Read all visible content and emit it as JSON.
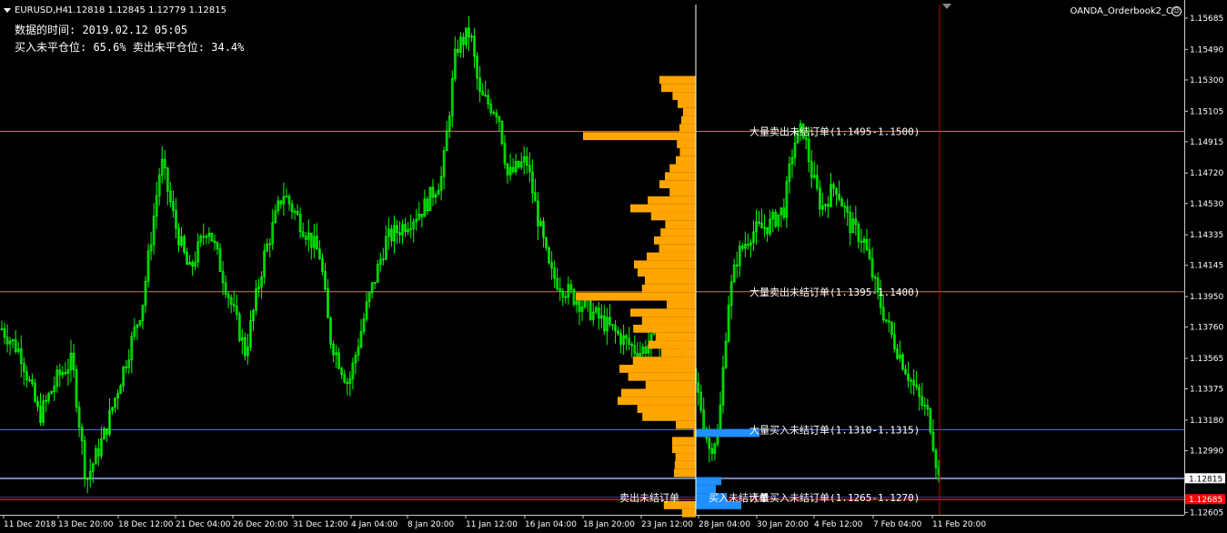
{
  "header": {
    "symbol": "EURUSD,H4",
    "ohlc": "1.12818 1.12845 1.12779 1.12815",
    "data_time_label": "数据的时间: 2019.02.12 05:05",
    "position_label": "买入未平仓位: 65.6% 卖出未平仓位: 34.4%",
    "indicator_name": "OANDA_Orderbook2_C"
  },
  "colors": {
    "background": "#000000",
    "candle": "#00ff00",
    "sell_orders": "#ffa500",
    "buy_orders": "#1e90ff",
    "sell_level_line": "#d07a45",
    "buy_level_line": "#4a6fd8",
    "bid_line": "#aab4c8",
    "ask_line": "#ff0000",
    "crosshair": "#ffffff",
    "vline_red": "#c00000",
    "axis_text": "#ffffff"
  },
  "icons": [
    "dropdown-triangle-icon",
    "smiley-icon",
    "shift-marker-icon"
  ],
  "chart_data": {
    "type": "candlestick-with-orderbook-histogram",
    "symbol": "EURUSD",
    "timeframe": "H4",
    "y_axis": {
      "ticks": [
        1.15685,
        1.1549,
        1.153,
        1.15105,
        1.14915,
        1.1472,
        1.1453,
        1.14335,
        1.14145,
        1.1395,
        1.1376,
        1.13565,
        1.13375,
        1.1318,
        1.1299,
        1.12605
      ],
      "tick_labels": [
        "1.15685",
        "1.15490",
        "1.15300",
        "1.15105",
        "1.14915",
        "1.14720",
        "1.14530",
        "1.14335",
        "1.14145",
        "1.13950",
        "1.13760",
        "1.13565",
        "1.13375",
        "1.13180",
        "1.12990",
        "1.12605"
      ],
      "ylim": [
        1.1259,
        1.1577
      ]
    },
    "x_axis": {
      "ticks": [
        "11 Dec 2018",
        "13 Dec 20:00",
        "18 Dec 12:00",
        "21 Dec 04:00",
        "26 Dec 20:00",
        "31 Dec 12:00",
        "4 Jan 04:00",
        "8 Jan 20:00",
        "11 Jan 12:00",
        "16 Jan 04:00",
        "18 Jan 20:00",
        "23 Jan 12:00",
        "28 Jan 04:00",
        "30 Jan 20:00",
        "4 Feb 12:00",
        "7 Feb 04:00",
        "11 Feb 20:00"
      ]
    },
    "price_path": [
      [
        0,
        1.1375
      ],
      [
        0.02,
        1.136
      ],
      [
        0.04,
        1.132
      ],
      [
        0.06,
        1.1345
      ],
      [
        0.075,
        1.1355
      ],
      [
        0.09,
        1.128
      ],
      [
        0.11,
        1.131
      ],
      [
        0.13,
        1.135
      ],
      [
        0.15,
        1.139
      ],
      [
        0.17,
        1.148
      ],
      [
        0.185,
        1.144
      ],
      [
        0.2,
        1.141
      ],
      [
        0.22,
        1.144
      ],
      [
        0.24,
        1.14
      ],
      [
        0.26,
        1.136
      ],
      [
        0.28,
        1.142
      ],
      [
        0.3,
        1.146
      ],
      [
        0.32,
        1.144
      ],
      [
        0.34,
        1.142
      ],
      [
        0.35,
        1.137
      ],
      [
        0.37,
        1.134
      ],
      [
        0.39,
        1.139
      ],
      [
        0.41,
        1.143
      ],
      [
        0.43,
        1.144
      ],
      [
        0.45,
        1.145
      ],
      [
        0.47,
        1.147
      ],
      [
        0.485,
        1.155
      ],
      [
        0.5,
        1.156
      ],
      [
        0.51,
        1.152
      ],
      [
        0.53,
        1.151
      ],
      [
        0.54,
        1.147
      ],
      [
        0.56,
        1.148
      ],
      [
        0.57,
        1.145
      ],
      [
        0.585,
        1.141
      ],
      [
        0.6,
        1.14
      ],
      [
        0.62,
        1.139
      ],
      [
        0.64,
        1.138
      ],
      [
        0.66,
        1.137
      ],
      [
        0.68,
        1.136
      ],
      [
        0.7,
        1.137
      ],
      [
        0.715,
        1.135
      ],
      [
        0.73,
        1.136
      ],
      [
        0.745,
        1.133
      ],
      [
        0.755,
        1.13
      ],
      [
        0.765,
        1.131
      ],
      [
        0.775,
        1.139
      ],
      [
        0.785,
        1.142
      ],
      [
        0.8,
        1.1435
      ],
      [
        0.82,
        1.144
      ],
      [
        0.835,
        1.145
      ],
      [
        0.845,
        1.149
      ],
      [
        0.855,
        1.15
      ],
      [
        0.865,
        1.147
      ],
      [
        0.875,
        1.145
      ],
      [
        0.89,
        1.1465
      ],
      [
        0.905,
        1.144
      ],
      [
        0.92,
        1.143
      ],
      [
        0.935,
        1.1395
      ],
      [
        0.95,
        1.137
      ],
      [
        0.965,
        1.135
      ],
      [
        0.98,
        1.133
      ],
      [
        0.99,
        1.132
      ],
      [
        1.0,
        1.1282
      ]
    ],
    "orderbook_sell": [
      [
        1.153,
        1.0
      ],
      [
        1.1525,
        0.95
      ],
      [
        1.152,
        0.64
      ],
      [
        1.1515,
        0.5
      ],
      [
        1.151,
        0.35
      ],
      [
        1.1505,
        0.4
      ],
      [
        1.15,
        0.45
      ],
      [
        1.1495,
        3.1
      ],
      [
        1.149,
        0.52
      ],
      [
        1.1485,
        0.44
      ],
      [
        1.148,
        0.55
      ],
      [
        1.1475,
        0.72
      ],
      [
        1.147,
        0.85
      ],
      [
        1.1465,
        1.0
      ],
      [
        1.146,
        0.72
      ],
      [
        1.1455,
        1.32
      ],
      [
        1.145,
        1.8
      ],
      [
        1.1445,
        1.23
      ],
      [
        1.144,
        0.84
      ],
      [
        1.1435,
        0.97
      ],
      [
        1.143,
        1.15
      ],
      [
        1.1425,
        1.01
      ],
      [
        1.142,
        1.35
      ],
      [
        1.1415,
        1.7
      ],
      [
        1.141,
        1.6
      ],
      [
        1.1405,
        1.4
      ],
      [
        1.14,
        1.48
      ],
      [
        1.1395,
        3.3
      ],
      [
        1.139,
        0.8
      ],
      [
        1.1385,
        1.8
      ],
      [
        1.138,
        1.48
      ],
      [
        1.1375,
        1.72
      ],
      [
        1.137,
        1.1
      ],
      [
        1.1365,
        1.31
      ],
      [
        1.136,
        0.95
      ],
      [
        1.1355,
        1.73
      ],
      [
        1.135,
        2.1
      ],
      [
        1.1345,
        1.86
      ],
      [
        1.134,
        1.38
      ],
      [
        1.1335,
        2.05
      ],
      [
        1.133,
        2.15
      ],
      [
        1.1325,
        1.61
      ],
      [
        1.132,
        1.47
      ],
      [
        1.1315,
        0.55
      ],
      [
        1.131,
        0.06
      ],
      [
        1.1305,
        0.65
      ],
      [
        1.13,
        0.65
      ],
      [
        1.1295,
        0.56
      ],
      [
        1.129,
        0.58
      ],
      [
        1.1285,
        0.6
      ],
      [
        1.128,
        0.0
      ],
      [
        1.1275,
        0.0
      ],
      [
        1.127,
        0.0
      ],
      [
        1.1265,
        0.88
      ],
      [
        1.126,
        0.38
      ]
    ],
    "orderbook_buy": [
      [
        1.131,
        1.75
      ],
      [
        1.128,
        0.7
      ],
      [
        1.1275,
        0.55
      ],
      [
        1.127,
        0.85
      ],
      [
        1.1265,
        1.25
      ]
    ],
    "levels": {
      "bid": 1.12815,
      "bid_label": "1.12815",
      "ask": 1.12685,
      "ask_label": "1.12685",
      "sell_big": [
        1.1498,
        1.1398
      ],
      "buy_big": [
        1.1312,
        1.1282
      ],
      "blue_line": 1.127
    },
    "annotations": [
      "大量卖出未结订单(1.1495-1.1500)",
      "大量卖出未结订单(1.1395-1.1400)",
      "大量买入未结订单(1.1310-1.1315)",
      "大量买入未结订单(1.1265-1.1270)",
      "卖出未结订单",
      "买入未结订单"
    ]
  }
}
